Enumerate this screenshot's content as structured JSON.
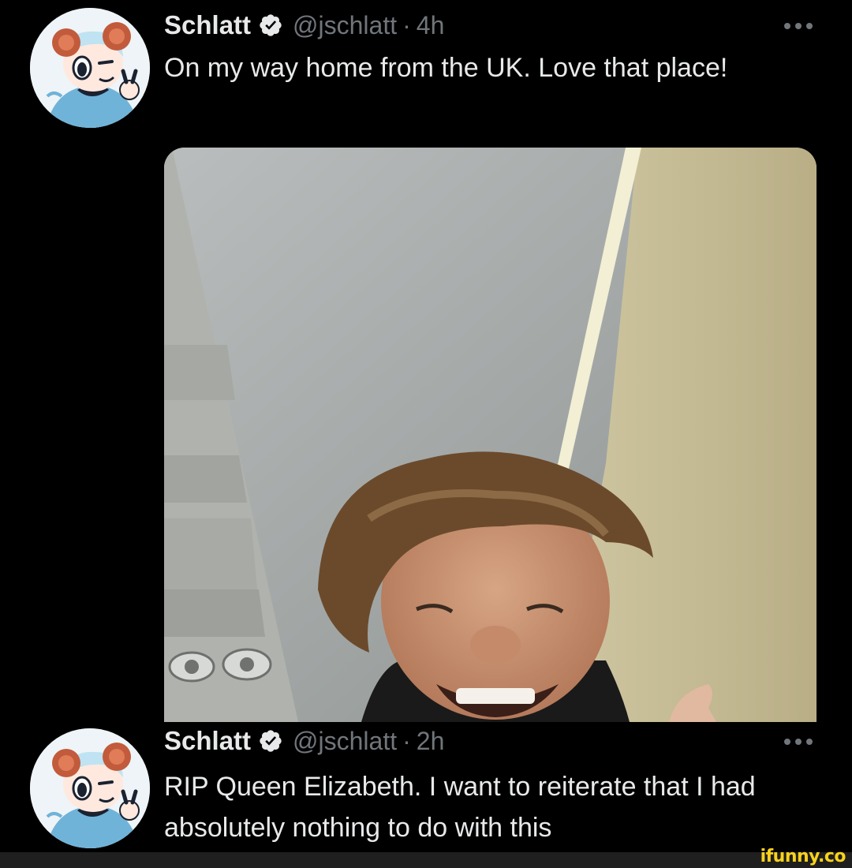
{
  "colors": {
    "background": "#000000",
    "text_primary": "#e7e9ea",
    "text_secondary": "#71767b",
    "verified_badge": "#e7e9ea",
    "watermark": "#f8d21c"
  },
  "tweets": [
    {
      "display_name": "Schlatt",
      "verified_icon": "verified-badge-icon",
      "handle": "@jschlatt",
      "separator": "·",
      "time": "4h",
      "more_icon": "more-options-icon",
      "text": "On my way home from the UK. Love that place!",
      "media_icon": "photo"
    },
    {
      "display_name": "Schlatt",
      "verified_icon": "verified-badge-icon",
      "handle": "@jschlatt",
      "separator": "·",
      "time": "2h",
      "more_icon": "more-options-icon",
      "text": "RIP Queen Elizabeth. I want to reiterate that I had absolutely nothing to do with this"
    }
  ],
  "watermark": {
    "text": "ifunny.co"
  }
}
